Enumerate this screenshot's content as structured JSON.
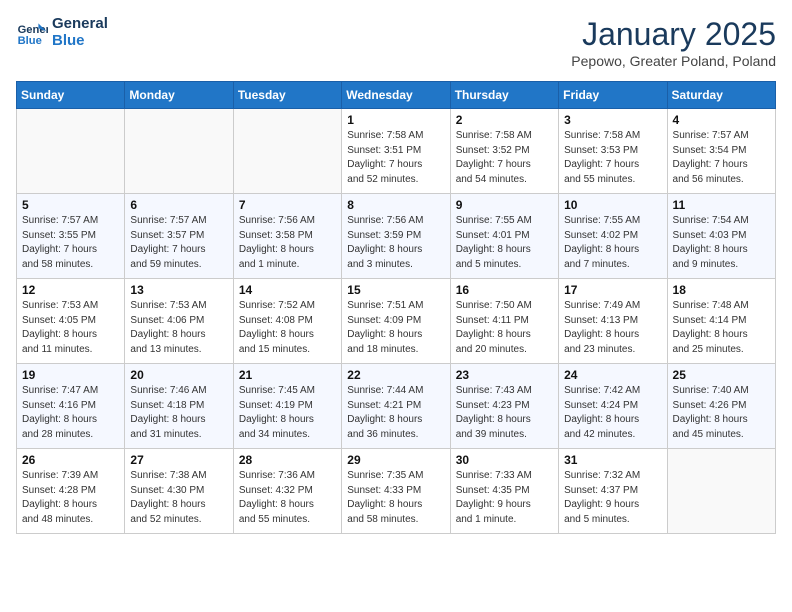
{
  "logo": {
    "line1": "General",
    "line2": "Blue"
  },
  "title": "January 2025",
  "subtitle": "Pepowo, Greater Poland, Poland",
  "days_of_week": [
    "Sunday",
    "Monday",
    "Tuesday",
    "Wednesday",
    "Thursday",
    "Friday",
    "Saturday"
  ],
  "weeks": [
    [
      {
        "day": "",
        "info": ""
      },
      {
        "day": "",
        "info": ""
      },
      {
        "day": "",
        "info": ""
      },
      {
        "day": "1",
        "info": "Sunrise: 7:58 AM\nSunset: 3:51 PM\nDaylight: 7 hours\nand 52 minutes."
      },
      {
        "day": "2",
        "info": "Sunrise: 7:58 AM\nSunset: 3:52 PM\nDaylight: 7 hours\nand 54 minutes."
      },
      {
        "day": "3",
        "info": "Sunrise: 7:58 AM\nSunset: 3:53 PM\nDaylight: 7 hours\nand 55 minutes."
      },
      {
        "day": "4",
        "info": "Sunrise: 7:57 AM\nSunset: 3:54 PM\nDaylight: 7 hours\nand 56 minutes."
      }
    ],
    [
      {
        "day": "5",
        "info": "Sunrise: 7:57 AM\nSunset: 3:55 PM\nDaylight: 7 hours\nand 58 minutes."
      },
      {
        "day": "6",
        "info": "Sunrise: 7:57 AM\nSunset: 3:57 PM\nDaylight: 7 hours\nand 59 minutes."
      },
      {
        "day": "7",
        "info": "Sunrise: 7:56 AM\nSunset: 3:58 PM\nDaylight: 8 hours\nand 1 minute."
      },
      {
        "day": "8",
        "info": "Sunrise: 7:56 AM\nSunset: 3:59 PM\nDaylight: 8 hours\nand 3 minutes."
      },
      {
        "day": "9",
        "info": "Sunrise: 7:55 AM\nSunset: 4:01 PM\nDaylight: 8 hours\nand 5 minutes."
      },
      {
        "day": "10",
        "info": "Sunrise: 7:55 AM\nSunset: 4:02 PM\nDaylight: 8 hours\nand 7 minutes."
      },
      {
        "day": "11",
        "info": "Sunrise: 7:54 AM\nSunset: 4:03 PM\nDaylight: 8 hours\nand 9 minutes."
      }
    ],
    [
      {
        "day": "12",
        "info": "Sunrise: 7:53 AM\nSunset: 4:05 PM\nDaylight: 8 hours\nand 11 minutes."
      },
      {
        "day": "13",
        "info": "Sunrise: 7:53 AM\nSunset: 4:06 PM\nDaylight: 8 hours\nand 13 minutes."
      },
      {
        "day": "14",
        "info": "Sunrise: 7:52 AM\nSunset: 4:08 PM\nDaylight: 8 hours\nand 15 minutes."
      },
      {
        "day": "15",
        "info": "Sunrise: 7:51 AM\nSunset: 4:09 PM\nDaylight: 8 hours\nand 18 minutes."
      },
      {
        "day": "16",
        "info": "Sunrise: 7:50 AM\nSunset: 4:11 PM\nDaylight: 8 hours\nand 20 minutes."
      },
      {
        "day": "17",
        "info": "Sunrise: 7:49 AM\nSunset: 4:13 PM\nDaylight: 8 hours\nand 23 minutes."
      },
      {
        "day": "18",
        "info": "Sunrise: 7:48 AM\nSunset: 4:14 PM\nDaylight: 8 hours\nand 25 minutes."
      }
    ],
    [
      {
        "day": "19",
        "info": "Sunrise: 7:47 AM\nSunset: 4:16 PM\nDaylight: 8 hours\nand 28 minutes."
      },
      {
        "day": "20",
        "info": "Sunrise: 7:46 AM\nSunset: 4:18 PM\nDaylight: 8 hours\nand 31 minutes."
      },
      {
        "day": "21",
        "info": "Sunrise: 7:45 AM\nSunset: 4:19 PM\nDaylight: 8 hours\nand 34 minutes."
      },
      {
        "day": "22",
        "info": "Sunrise: 7:44 AM\nSunset: 4:21 PM\nDaylight: 8 hours\nand 36 minutes."
      },
      {
        "day": "23",
        "info": "Sunrise: 7:43 AM\nSunset: 4:23 PM\nDaylight: 8 hours\nand 39 minutes."
      },
      {
        "day": "24",
        "info": "Sunrise: 7:42 AM\nSunset: 4:24 PM\nDaylight: 8 hours\nand 42 minutes."
      },
      {
        "day": "25",
        "info": "Sunrise: 7:40 AM\nSunset: 4:26 PM\nDaylight: 8 hours\nand 45 minutes."
      }
    ],
    [
      {
        "day": "26",
        "info": "Sunrise: 7:39 AM\nSunset: 4:28 PM\nDaylight: 8 hours\nand 48 minutes."
      },
      {
        "day": "27",
        "info": "Sunrise: 7:38 AM\nSunset: 4:30 PM\nDaylight: 8 hours\nand 52 minutes."
      },
      {
        "day": "28",
        "info": "Sunrise: 7:36 AM\nSunset: 4:32 PM\nDaylight: 8 hours\nand 55 minutes."
      },
      {
        "day": "29",
        "info": "Sunrise: 7:35 AM\nSunset: 4:33 PM\nDaylight: 8 hours\nand 58 minutes."
      },
      {
        "day": "30",
        "info": "Sunrise: 7:33 AM\nSunset: 4:35 PM\nDaylight: 9 hours\nand 1 minute."
      },
      {
        "day": "31",
        "info": "Sunrise: 7:32 AM\nSunset: 4:37 PM\nDaylight: 9 hours\nand 5 minutes."
      },
      {
        "day": "",
        "info": ""
      }
    ]
  ]
}
